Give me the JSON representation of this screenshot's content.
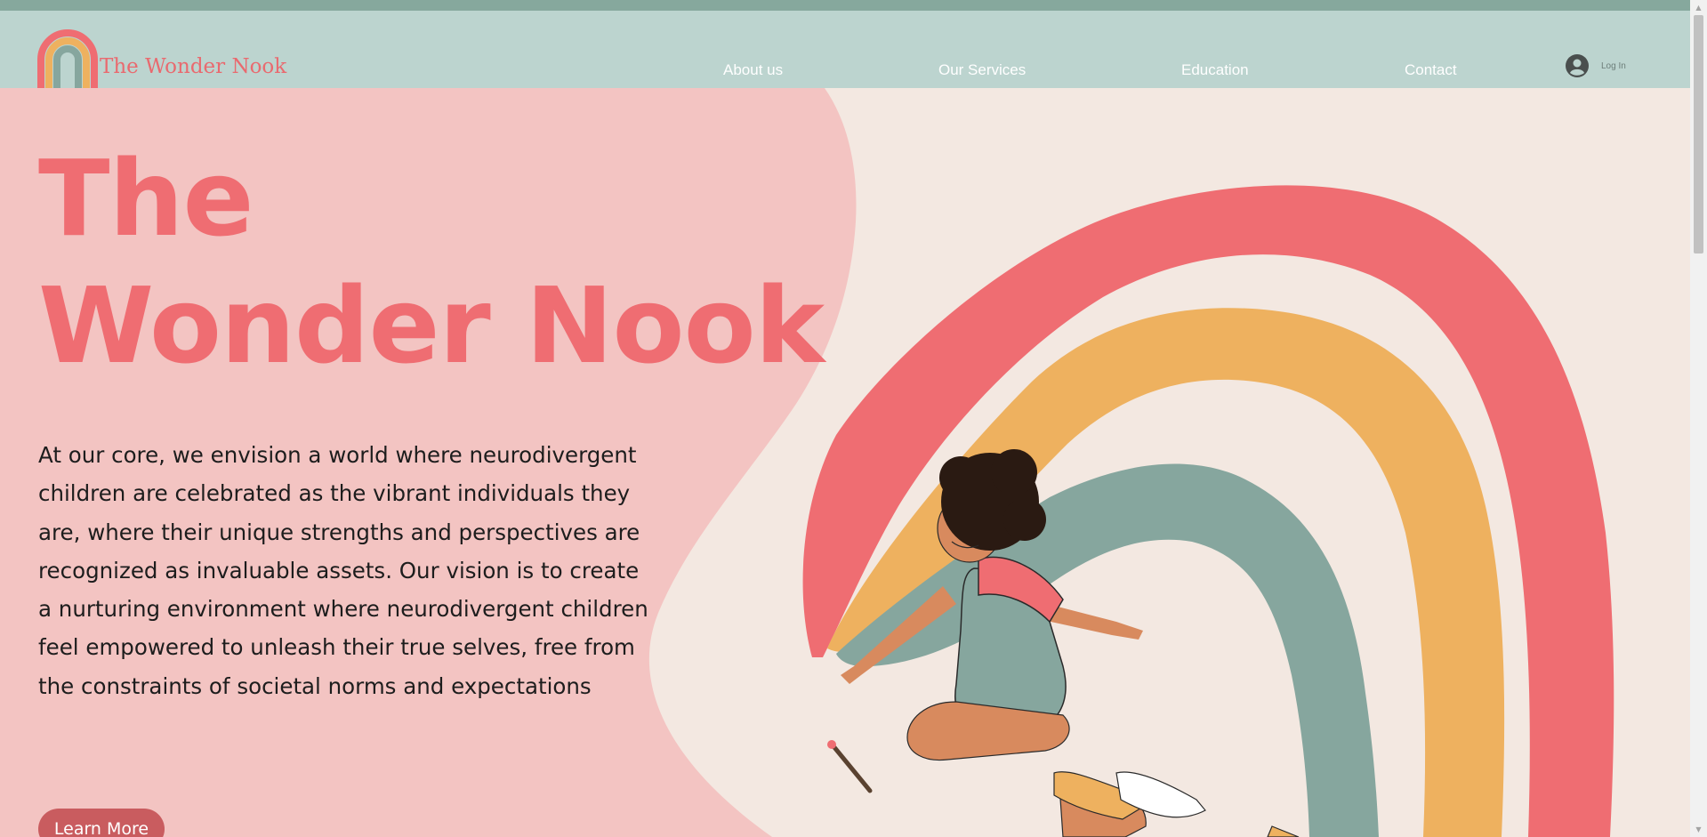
{
  "header": {
    "brand": "The Wonder Nook",
    "nav": [
      {
        "label": "About us"
      },
      {
        "label": "Our Services"
      },
      {
        "label": "Education"
      },
      {
        "label": "Contact"
      }
    ],
    "login_label": "Log In"
  },
  "hero": {
    "title_line1": "The",
    "title_line2": "Wonder Nook",
    "paragraph": "At our core, we envision a world where neurodivergent children are celebrated as the vibrant individuals they are, where their unique strengths and perspectives are recognized as invaluable assets. Our vision is to create a nurturing environment where neurodivergent children feel empowered to unleash their true selves, free from the constraints of societal norms and expectations",
    "cta_label": "Learn More"
  },
  "colors": {
    "header_bg": "#bcd4cf",
    "top_strip": "#86a89d",
    "accent_coral": "#ef6d72",
    "hero_pink": "#f3c4c2",
    "hero_cream": "#f3e8e1",
    "rainbow_yellow": "#eeb15f",
    "rainbow_teal": "#86a69e",
    "button_bg": "#c95c5f"
  },
  "icons": [
    "rainbow-logo-icon",
    "user-avatar-icon",
    "scroll-up-arrow-icon",
    "scroll-down-arrow-icon"
  ]
}
